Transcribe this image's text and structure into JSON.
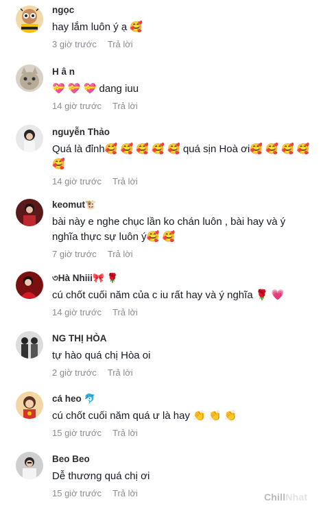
{
  "comments": [
    {
      "name": "ngọc",
      "text": "hay lắm luôn ý ạ 🥰",
      "time": "3 giờ trước",
      "reply": "Trả lời"
    },
    {
      "name": "H â n",
      "text": "💝 💝 💝  dang iuu",
      "time": "14 giờ trước",
      "reply": "Trả lời"
    },
    {
      "name": "nguyễn Thảo",
      "text": "Quá là đỉnh🥰 🥰 🥰 🥰 🥰  quá sịn Hoà ơi🥰 🥰 🥰 🥰 🥰",
      "time": "14 giờ trước",
      "reply": "Trả lời"
    },
    {
      "name": "keomut🐮",
      "text": "bài này e nghe chục lần ko chán luôn , bài hay và ý nghĩa thực sự luôn ý🥰 🥰",
      "time": "7 giờ trước",
      "reply": "Trả lời"
    },
    {
      "name": "৩Hà Nhiii🎀 🌹",
      "text": "cú chốt cuối năm của c iu rất hay và ý nghĩa 🌹 💗",
      "time": "14 giờ trước",
      "reply": "Trả lời"
    },
    {
      "name": "NG THỊ HÒA",
      "text": "tự hào quá chị Hòa oi",
      "time": "2 giờ trước",
      "reply": "Trả lời"
    },
    {
      "name": "cá heo 🐬",
      "text": "cú chốt cuối năm quá ư là hay 👏 👏 👏",
      "time": "15 giờ trước",
      "reply": "Trả lời"
    },
    {
      "name": "Beo Beo",
      "text": "Dễ thương quá chị ơi",
      "time": "15 giờ trước",
      "reply": "Trả lời"
    }
  ],
  "watermark": {
    "part1": "Chill",
    "part2": "Nhat"
  },
  "colors": {
    "name": "#2b2b33",
    "text": "#161823",
    "meta": "#8a8b91",
    "background": "#ffffff"
  }
}
